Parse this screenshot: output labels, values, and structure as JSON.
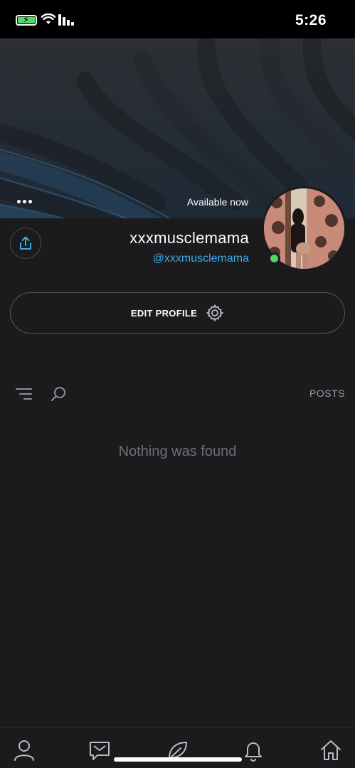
{
  "status_bar": {
    "time": "5:26",
    "battery_level": 1.0,
    "battery_color": "#4cd964"
  },
  "profile": {
    "availability": "Available now",
    "display_name": "xxxmusclemama",
    "username": "@xxxmusclemama",
    "online": true,
    "online_color": "#4cd964",
    "username_color": "#3ea8e4"
  },
  "actions": {
    "edit_profile_label": "EDIT PROFILE"
  },
  "posts": {
    "label": "POSTS",
    "empty_message": "Nothing was found"
  },
  "icons": {
    "more": "more-icon",
    "share": "share-icon",
    "gear": "gear-icon",
    "search": "search-icon",
    "filter": "filter-icon",
    "nav": [
      "profile-icon",
      "messages-icon",
      "create-post-icon",
      "notifications-icon",
      "home-icon"
    ]
  }
}
